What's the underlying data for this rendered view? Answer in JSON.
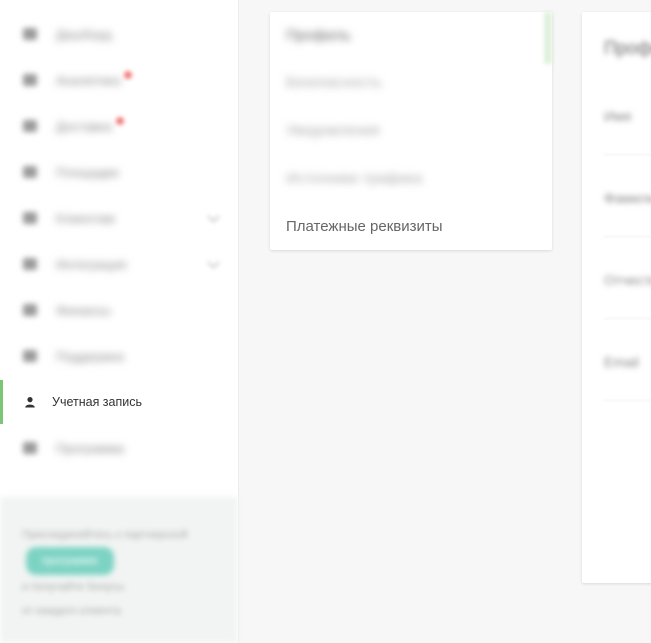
{
  "sidebar": {
    "items": [
      {
        "label": "Дашборд",
        "icon": "dashboard-icon",
        "blurred": true
      },
      {
        "label": "Аналитика",
        "icon": "analytics-icon",
        "blurred": true,
        "dot": true
      },
      {
        "label": "Доставка",
        "icon": "delivery-icon",
        "blurred": true,
        "dot": true
      },
      {
        "label": "Площадки",
        "icon": "storefront-icon",
        "blurred": true
      },
      {
        "label": "Клиентам",
        "icon": "clients-icon",
        "blurred": true,
        "chevron": true
      },
      {
        "label": "Интеграция",
        "icon": "integration-icon",
        "blurred": true,
        "chevron": true
      },
      {
        "label": "Финансы",
        "icon": "finance-icon",
        "blurred": true
      },
      {
        "label": "Поддержка",
        "icon": "support-icon",
        "blurred": true
      },
      {
        "label": "Учетная запись",
        "icon": "user-icon",
        "active": true
      },
      {
        "label": "Программа",
        "icon": "program-icon",
        "blurred": true
      }
    ],
    "promo": {
      "line1": "Присоединяйтесь к партнерской",
      "pill": "программе",
      "line2": "и получайте бонусы",
      "line3": "от каждого клиента"
    }
  },
  "settings_menu": {
    "items": [
      {
        "label": "Профиль",
        "blurred": true
      },
      {
        "label": "Безопасность",
        "blurred": true
      },
      {
        "label": "Уведомления",
        "blurred": true
      },
      {
        "label": "Источники трафика",
        "blurred": true
      },
      {
        "label": "Платежные реквизиты",
        "blurred": false
      }
    ]
  },
  "profile_panel": {
    "title": "Профиль",
    "fields": [
      "Имя",
      "Фамилия",
      "Отчество",
      "Email"
    ]
  },
  "colors": {
    "accent_green": "#7cc576",
    "page_bg": "#f7f7f7"
  }
}
